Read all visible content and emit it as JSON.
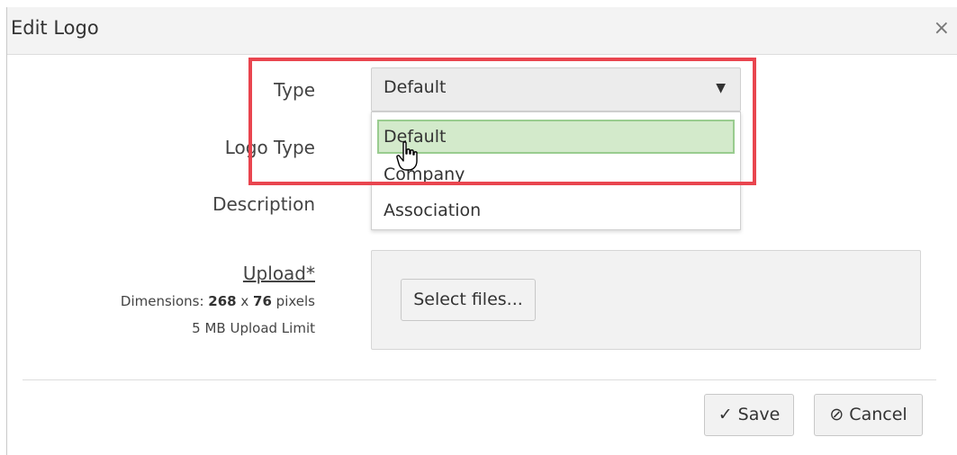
{
  "dialog": {
    "title": "Edit Logo",
    "close_glyph": "×"
  },
  "form": {
    "type_label": "Type",
    "type_value": "Default",
    "logo_type_label": "Logo Type",
    "description_label": "Description",
    "upload_label": "Upload*",
    "dimensions_prefix": "Dimensions: ",
    "dimensions_width": "268",
    "dimensions_sep": " x ",
    "dimensions_height": "76",
    "dimensions_suffix": " pixels",
    "upload_limit": "5 MB Upload Limit"
  },
  "dropdown": {
    "options": [
      "Default",
      "Company",
      "Association"
    ],
    "selected": "Default"
  },
  "buttons": {
    "select_files": "Select files...",
    "save": "Save",
    "cancel": "Cancel"
  },
  "icons": {
    "caret": "caret-down-icon",
    "check": "check-icon",
    "cancel": "ban-icon",
    "cursor": "hand-pointer-icon"
  },
  "colors": {
    "highlight_border": "#e9454f",
    "selected_option_bg": "#d3eacb",
    "selected_option_border": "#99cc8f"
  }
}
